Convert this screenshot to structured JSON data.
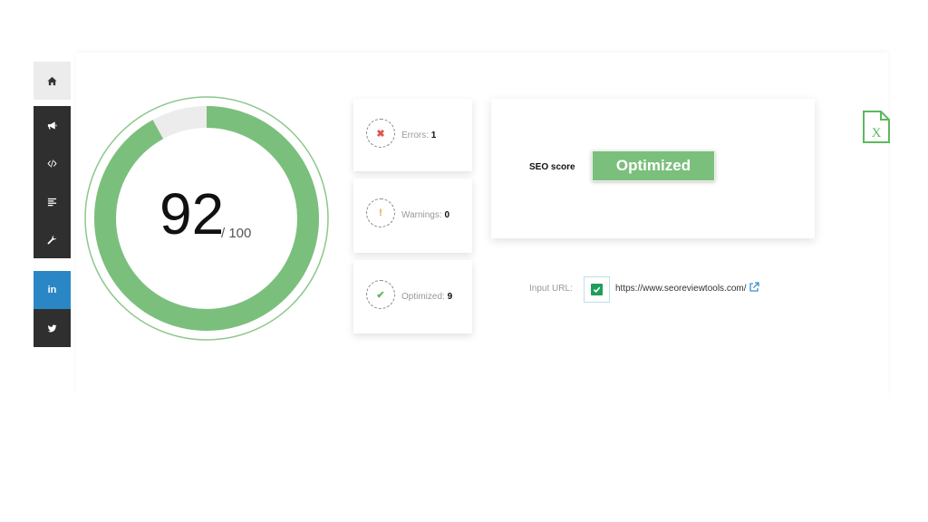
{
  "sidebar": {
    "items": [
      {
        "name": "home",
        "icon": "home-icon"
      },
      {
        "name": "announce",
        "icon": "megaphone-icon"
      },
      {
        "name": "code",
        "icon": "code-icon"
      },
      {
        "name": "list",
        "icon": "align-left-icon"
      },
      {
        "name": "tools",
        "icon": "wrench-icon"
      },
      {
        "name": "linkedin",
        "icon": "linkedin-icon",
        "label": "in"
      },
      {
        "name": "twitter",
        "icon": "twitter-icon"
      }
    ]
  },
  "score": {
    "value": "92",
    "max": "/ 100",
    "fraction": 0.92,
    "color": "#7bbf7c"
  },
  "stats": {
    "errors": {
      "label": "Errors:",
      "count": "1",
      "color": "#e0524d"
    },
    "warnings": {
      "label": "Warnings:",
      "count": "0",
      "color": "#e8a33d"
    },
    "optimized": {
      "label": "Optimized:",
      "count": "9",
      "color": "#5cb85c"
    }
  },
  "seo": {
    "label": "SEO score",
    "status": "Optimized"
  },
  "input": {
    "label": "Input URL:",
    "url": "https://www.seoreviewtools.com/"
  },
  "export": {
    "icon": "excel-icon",
    "letter": "X",
    "color": "#5cb85c"
  }
}
